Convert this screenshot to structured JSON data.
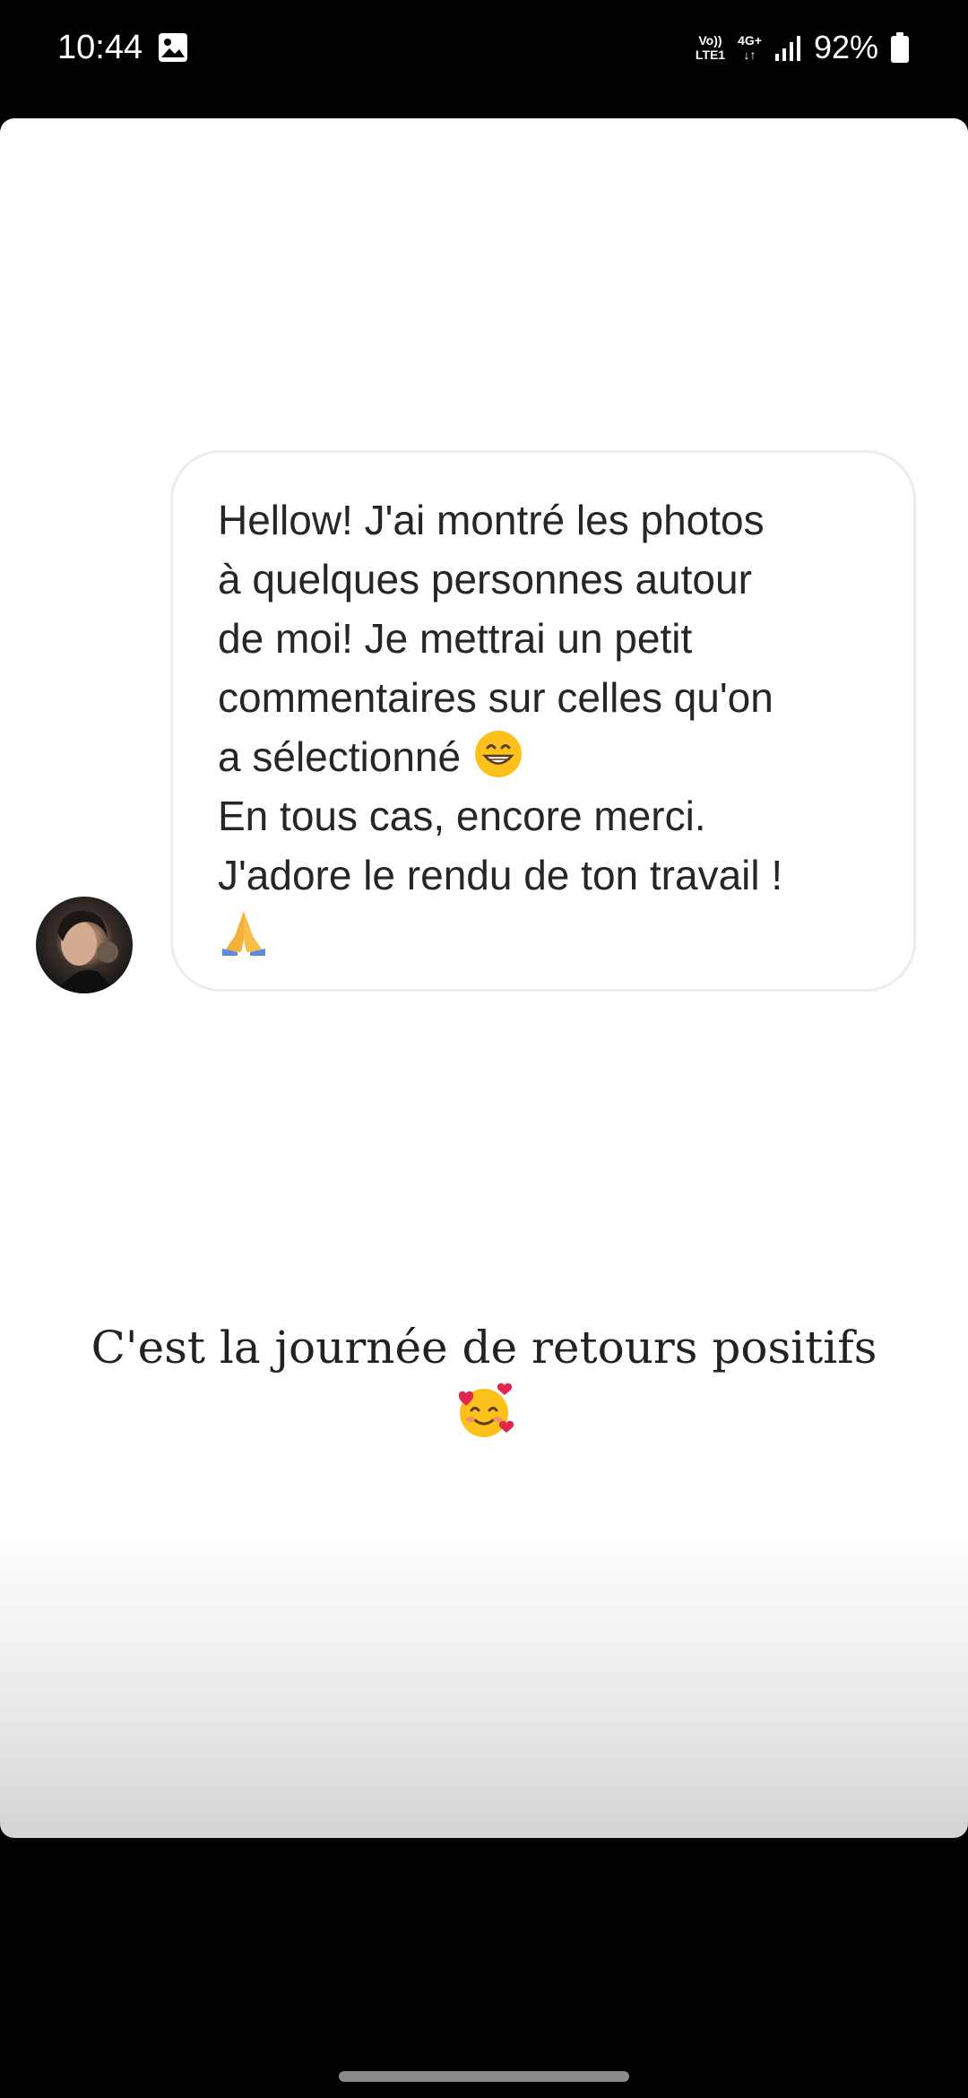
{
  "status_bar": {
    "time": "10:44",
    "net_volte": "Vo))",
    "net_lte": "LTE1",
    "net_gen": "4G+",
    "net_arrows": "↓↑",
    "battery_percent": "92%",
    "icons": [
      "gallery-icon",
      "signal-icon",
      "battery-icon"
    ]
  },
  "story": {
    "message_text": "Hellow! J'ai montré les photos\nà quelques personnes autour\nde moi! Je mettrai un petit\ncommentaires sur celles qu'on\na sélectionné ",
    "message_text_after": "\nEn tous cas, encore merci.\nJ'adore le rendu de ton travail !\n",
    "message_emojis": [
      "grinning-face-emoji",
      "folded-hands-emoji"
    ],
    "caption": "C'est la journée de retours positifs",
    "caption_emoji": "smiling-face-with-hearts-emoji",
    "avatar": "sender-avatar"
  },
  "colors": {
    "background": "#000000",
    "card": "#ffffff",
    "bubble_border": "#ececec",
    "text": "#262626"
  }
}
